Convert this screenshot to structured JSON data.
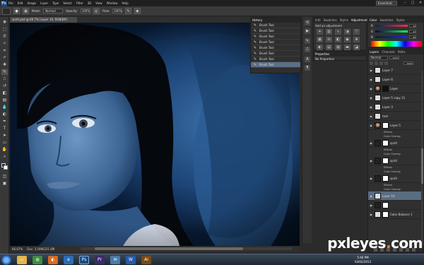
{
  "app": {
    "logo": "Ps",
    "menu": [
      "File",
      "Edit",
      "Image",
      "Layer",
      "Type",
      "Select",
      "Filter",
      "3D",
      "View",
      "Window",
      "Help"
    ],
    "workspace": "Essentials",
    "window_controls": [
      "–",
      "□",
      "✕"
    ]
  },
  "options_bar": {
    "mode_label": "Mode:",
    "mode_value": "Normal",
    "opacity_label": "Opacity:",
    "opacity_value": "100%",
    "flow_label": "Flow:",
    "flow_value": "100%"
  },
  "document": {
    "tab_title": "spirit.psd @ 66.7% (Layer 10, RGB/8#)",
    "zoom": "66.67%",
    "doc_size": "Doc: 3.56M/221.6M"
  },
  "history": {
    "tabs": [
      "History"
    ],
    "items": [
      "Brush Tool",
      "Brush Tool",
      "Brush Tool",
      "Brush Tool",
      "Brush Tool",
      "Brush Tool",
      "Brush Tool",
      "Brush Tool"
    ]
  },
  "adjustments": {
    "tabs": [
      "Info",
      "Swatches",
      "Styles",
      "Adjustments"
    ],
    "title": "Add an adjustment"
  },
  "properties": {
    "tab": "Properties",
    "text": "No Properties"
  },
  "color_panel": {
    "tabs": [
      "Color",
      "Swatches",
      "Styles"
    ],
    "channels": [
      {
        "label": "R",
        "value": "10"
      },
      {
        "label": "G",
        "value": "42"
      },
      {
        "label": "B",
        "value": "86"
      }
    ]
  },
  "layers": {
    "tabs": [
      "Layers",
      "Channels",
      "Paths"
    ],
    "blend_mode": "Normal",
    "opacity": "100%",
    "fill": "100%",
    "rows": [
      {
        "kind": "layer",
        "name": "Layer 7",
        "thumb": "plain",
        "mask": false,
        "selected": false
      },
      {
        "kind": "layer",
        "name": "Layer 6",
        "thumb": "plain",
        "mask": false,
        "selected": false
      },
      {
        "kind": "layer",
        "name": "Layer",
        "thumb": "face",
        "mask": true,
        "mask_black": true,
        "selected": false
      },
      {
        "kind": "layer",
        "name": "Layer 5 copy 11",
        "thumb": "plain",
        "mask": false,
        "selected": false
      },
      {
        "kind": "layer",
        "name": "Layer 3",
        "thumb": "plain",
        "mask": false,
        "selected": false
      },
      {
        "kind": "layer",
        "name": "text",
        "thumb": "plain",
        "mask": false,
        "selected": false
      },
      {
        "kind": "layer",
        "name": "Layer 5",
        "thumb": "face",
        "mask": true,
        "mask_black": false,
        "selected": false
      },
      {
        "kind": "fx",
        "name": "Effects"
      },
      {
        "kind": "fx",
        "name": "Color Overlay"
      },
      {
        "kind": "layer",
        "name": "spirit",
        "thumb": "dark",
        "mask": true,
        "mask_black": false,
        "selected": false
      },
      {
        "kind": "fx",
        "name": "Effects"
      },
      {
        "kind": "fx",
        "name": "Color Overlay"
      },
      {
        "kind": "layer",
        "name": "spirit",
        "thumb": "dark",
        "mask": true,
        "mask_black": false,
        "selected": false
      },
      {
        "kind": "fx",
        "name": "Effects"
      },
      {
        "kind": "fx",
        "name": "Color Overlay"
      },
      {
        "kind": "layer",
        "name": "spirit",
        "thumb": "dark",
        "mask": true,
        "mask_black": false,
        "selected": false
      },
      {
        "kind": "fx",
        "name": "Effects"
      },
      {
        "kind": "fx",
        "name": "Color Overlay"
      },
      {
        "kind": "layer",
        "name": "Layer 10",
        "thumb": "plain",
        "mask": false,
        "selected": true
      },
      {
        "kind": "layer",
        "name": "",
        "thumb": "dark",
        "mask": true,
        "mask_black": false,
        "selected": false
      },
      {
        "kind": "layer",
        "name": "Color Balance 1",
        "thumb": "plain",
        "mask": true,
        "mask_black": false,
        "selected": false
      }
    ]
  },
  "taskbar": {
    "apps": [
      "folder",
      "chrome",
      "firefox",
      "explorer",
      "photoshop",
      "premiere",
      "mail",
      "word",
      "illustrator"
    ],
    "clock_time": "5:46 PM",
    "clock_date": "03/02/2013"
  },
  "watermark": {
    "prefix": "pxleyes",
    "dot": ".",
    "suffix": "com"
  },
  "colors": {
    "canvas_blue": "#0a2a55",
    "selection_blue": "#5b6f86",
    "watermark_accent": "#ff7a1a"
  }
}
